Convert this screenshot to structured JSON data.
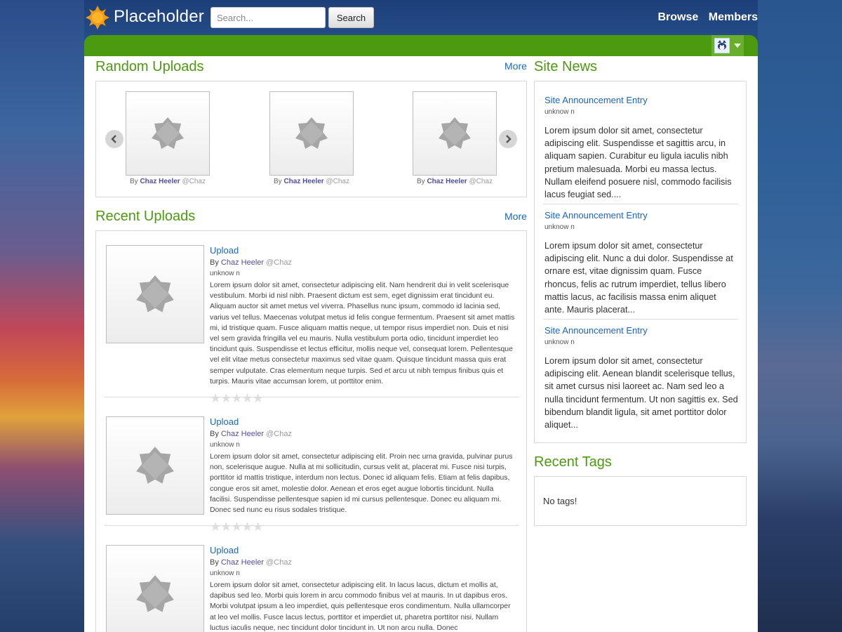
{
  "header": {
    "logo_text": "Placeholder",
    "search_placeholder": "Search...",
    "search_button": "Search",
    "nav": [
      "Browse",
      "Members"
    ]
  },
  "random_uploads": {
    "title": "Random Uploads",
    "more": "More",
    "items": [
      {
        "by": "By",
        "author": "Chaz Heeler",
        "handle": "@Chaz"
      },
      {
        "by": "By",
        "author": "Chaz Heeler",
        "handle": "@Chaz"
      },
      {
        "by": "By",
        "author": "Chaz Heeler",
        "handle": "@Chaz"
      }
    ]
  },
  "recent_uploads": {
    "title": "Recent Uploads",
    "more": "More",
    "items": [
      {
        "title": "Upload",
        "by": "By",
        "author": "Chaz Heeler",
        "handle": "@Chaz",
        "meta": "unknow n",
        "rating": 0,
        "description": "Lorem ipsum dolor sit amet, consectetur adipiscing elit. Nam hendrerit dui in velit scelerisque vestibulum. Morbi id nisl nibh. Praesent dictum est sem, eget dignissim erat tincidunt eu. Aliquam auctor sit amet metus vel viverra. Phasellus nunc ipsum, commodo id lacinia sed, varius vel tellus. Maecenas volutpat metus id felis congue fermentum. Praesent sit amet mattis mi, id tristique quam. Fusce aliquam mattis neque, ut tempor risus imperdiet non. Duis et nisi vel sem gravida fringilla vel eu mauris. Nulla vestibulum porta odio, tincidunt imperdiet leo tincidunt quis. Suspendisse et lectus efficitur, mollis neque vel, consequat lorem. Pellentesque vel elit vitae metus consectetur maximus sed vitae quam. Quisque tincidunt massa quis erat semper vulputate. Cras elementum neque turpis. Sed et arcu ut nibh tempus finibus quis et turpis. Mauris vitae accumsan lorem, ut porttitor enim."
      },
      {
        "title": "Upload",
        "by": "By",
        "author": "Chaz Heeler",
        "handle": "@Chaz",
        "meta": "unknow n",
        "rating": 0,
        "description": "Lorem ipsum dolor sit amet, consectetur adipiscing elit. Proin nec urna gravida, pulvinar purus non, scelerisque augue. Nulla at mi sollicitudin, cursus velit at, placerat mi. Fusce nisi turpis, porttitor id mattis tristique, interdum non lectus. Donec id aliquam felis. Etiam at felis dapibus, congue eros sit amet, molestie dolor. Aenean et eros eget augue lobortis tincidunt. Nulla facilisi. Suspendisse pellentesque sapien id mi cursus pellentesque. Donec eu aliquam mi. Donec sed nunc eu risus sodales tristique."
      },
      {
        "title": "Upload",
        "by": "By",
        "author": "Chaz Heeler",
        "handle": "@Chaz",
        "meta": "unknow n",
        "rating": 0,
        "description": "Lorem ipsum dolor sit amet, consectetur adipiscing elit. In lacus lacus, dictum et mollis at, dapibus sed leo. Morbi quis lorem in arcu commodo finibus vel at mauris. In ut dapibus eros. Morbi volutpat ipsum a leo imperdiet, quis pellentesque eros condimentum. Nulla ullamcorper at leo vel mollis. Fusce lacus lectus, porttitor et imperdiet ut, pharetra porttitor nisi. Nullam luctus iaculis neque, nec tincidunt dolor tincidunt in. Ut non arcu nulla. Donec"
      }
    ]
  },
  "site_news": {
    "title": "Site News",
    "items": [
      {
        "title": "Site Announcement Entry",
        "meta": "unknow n",
        "body": "Lorem ipsum dolor sit amet, consectetur adipiscing elit. Suspendisse et sagittis arcu, in aliquam sapien. Curabitur eu ligula iaculis nibh pretium malesuada. Morbi eu massa lectus. Nullam eleifend posuere nisl, commodo facilisis lacus feugiat sed...."
      },
      {
        "title": "Site Announcement Entry",
        "meta": "unknow n",
        "body": "Lorem ipsum dolor sit amet, consectetur adipiscing elit. Nunc a dui dolor. Suspendisse at ornare est, vitae dignissim quam. Fusce rhoncus, felis ac rutrum imperdiet, tellus libero mattis lacus, ac facilisis massa enim aliquet ante. Mauris placerat..."
      },
      {
        "title": "Site Announcement Entry",
        "meta": "unknow n",
        "body": "Lorem ipsum dolor sit amet, consectetur adipiscing elit. Aenean blandit scelerisque tellus, sit amet cursus nisi laoreet ac. Nam sed leo a nulla tincidunt fermentum. Ut non sagittis ex. Sed bibendum blandit ligula, sit amet porttitor dolor aliquet..."
      }
    ]
  },
  "recent_tags": {
    "title": "Recent Tags",
    "empty": "No tags!"
  },
  "colors": {
    "brand_green": "#4c9a10",
    "link_blue": "#1a66c2",
    "author_purple": "#4f4f9f"
  },
  "icons": [
    "logo-sun-icon",
    "user-avatar-icon",
    "chevron-left-icon",
    "chevron-right-icon",
    "placeholder-image-icon",
    "star-icon"
  ]
}
